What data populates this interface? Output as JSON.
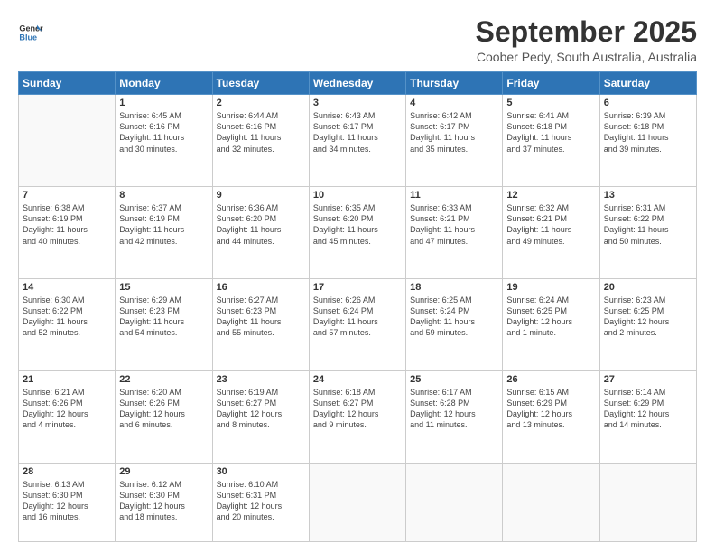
{
  "header": {
    "logo_line1": "General",
    "logo_line2": "Blue",
    "main_title": "September 2025",
    "subtitle": "Coober Pedy, South Australia, Australia"
  },
  "days": [
    "Sunday",
    "Monday",
    "Tuesday",
    "Wednesday",
    "Thursday",
    "Friday",
    "Saturday"
  ],
  "weeks": [
    [
      {
        "date": "",
        "info": ""
      },
      {
        "date": "1",
        "info": "Sunrise: 6:45 AM\nSunset: 6:16 PM\nDaylight: 11 hours\nand 30 minutes."
      },
      {
        "date": "2",
        "info": "Sunrise: 6:44 AM\nSunset: 6:16 PM\nDaylight: 11 hours\nand 32 minutes."
      },
      {
        "date": "3",
        "info": "Sunrise: 6:43 AM\nSunset: 6:17 PM\nDaylight: 11 hours\nand 34 minutes."
      },
      {
        "date": "4",
        "info": "Sunrise: 6:42 AM\nSunset: 6:17 PM\nDaylight: 11 hours\nand 35 minutes."
      },
      {
        "date": "5",
        "info": "Sunrise: 6:41 AM\nSunset: 6:18 PM\nDaylight: 11 hours\nand 37 minutes."
      },
      {
        "date": "6",
        "info": "Sunrise: 6:39 AM\nSunset: 6:18 PM\nDaylight: 11 hours\nand 39 minutes."
      }
    ],
    [
      {
        "date": "7",
        "info": "Sunrise: 6:38 AM\nSunset: 6:19 PM\nDaylight: 11 hours\nand 40 minutes."
      },
      {
        "date": "8",
        "info": "Sunrise: 6:37 AM\nSunset: 6:19 PM\nDaylight: 11 hours\nand 42 minutes."
      },
      {
        "date": "9",
        "info": "Sunrise: 6:36 AM\nSunset: 6:20 PM\nDaylight: 11 hours\nand 44 minutes."
      },
      {
        "date": "10",
        "info": "Sunrise: 6:35 AM\nSunset: 6:20 PM\nDaylight: 11 hours\nand 45 minutes."
      },
      {
        "date": "11",
        "info": "Sunrise: 6:33 AM\nSunset: 6:21 PM\nDaylight: 11 hours\nand 47 minutes."
      },
      {
        "date": "12",
        "info": "Sunrise: 6:32 AM\nSunset: 6:21 PM\nDaylight: 11 hours\nand 49 minutes."
      },
      {
        "date": "13",
        "info": "Sunrise: 6:31 AM\nSunset: 6:22 PM\nDaylight: 11 hours\nand 50 minutes."
      }
    ],
    [
      {
        "date": "14",
        "info": "Sunrise: 6:30 AM\nSunset: 6:22 PM\nDaylight: 11 hours\nand 52 minutes."
      },
      {
        "date": "15",
        "info": "Sunrise: 6:29 AM\nSunset: 6:23 PM\nDaylight: 11 hours\nand 54 minutes."
      },
      {
        "date": "16",
        "info": "Sunrise: 6:27 AM\nSunset: 6:23 PM\nDaylight: 11 hours\nand 55 minutes."
      },
      {
        "date": "17",
        "info": "Sunrise: 6:26 AM\nSunset: 6:24 PM\nDaylight: 11 hours\nand 57 minutes."
      },
      {
        "date": "18",
        "info": "Sunrise: 6:25 AM\nSunset: 6:24 PM\nDaylight: 11 hours\nand 59 minutes."
      },
      {
        "date": "19",
        "info": "Sunrise: 6:24 AM\nSunset: 6:25 PM\nDaylight: 12 hours\nand 1 minute."
      },
      {
        "date": "20",
        "info": "Sunrise: 6:23 AM\nSunset: 6:25 PM\nDaylight: 12 hours\nand 2 minutes."
      }
    ],
    [
      {
        "date": "21",
        "info": "Sunrise: 6:21 AM\nSunset: 6:26 PM\nDaylight: 12 hours\nand 4 minutes."
      },
      {
        "date": "22",
        "info": "Sunrise: 6:20 AM\nSunset: 6:26 PM\nDaylight: 12 hours\nand 6 minutes."
      },
      {
        "date": "23",
        "info": "Sunrise: 6:19 AM\nSunset: 6:27 PM\nDaylight: 12 hours\nand 8 minutes."
      },
      {
        "date": "24",
        "info": "Sunrise: 6:18 AM\nSunset: 6:27 PM\nDaylight: 12 hours\nand 9 minutes."
      },
      {
        "date": "25",
        "info": "Sunrise: 6:17 AM\nSunset: 6:28 PM\nDaylight: 12 hours\nand 11 minutes."
      },
      {
        "date": "26",
        "info": "Sunrise: 6:15 AM\nSunset: 6:29 PM\nDaylight: 12 hours\nand 13 minutes."
      },
      {
        "date": "27",
        "info": "Sunrise: 6:14 AM\nSunset: 6:29 PM\nDaylight: 12 hours\nand 14 minutes."
      }
    ],
    [
      {
        "date": "28",
        "info": "Sunrise: 6:13 AM\nSunset: 6:30 PM\nDaylight: 12 hours\nand 16 minutes."
      },
      {
        "date": "29",
        "info": "Sunrise: 6:12 AM\nSunset: 6:30 PM\nDaylight: 12 hours\nand 18 minutes."
      },
      {
        "date": "30",
        "info": "Sunrise: 6:10 AM\nSunset: 6:31 PM\nDaylight: 12 hours\nand 20 minutes."
      },
      {
        "date": "",
        "info": ""
      },
      {
        "date": "",
        "info": ""
      },
      {
        "date": "",
        "info": ""
      },
      {
        "date": "",
        "info": ""
      }
    ]
  ]
}
